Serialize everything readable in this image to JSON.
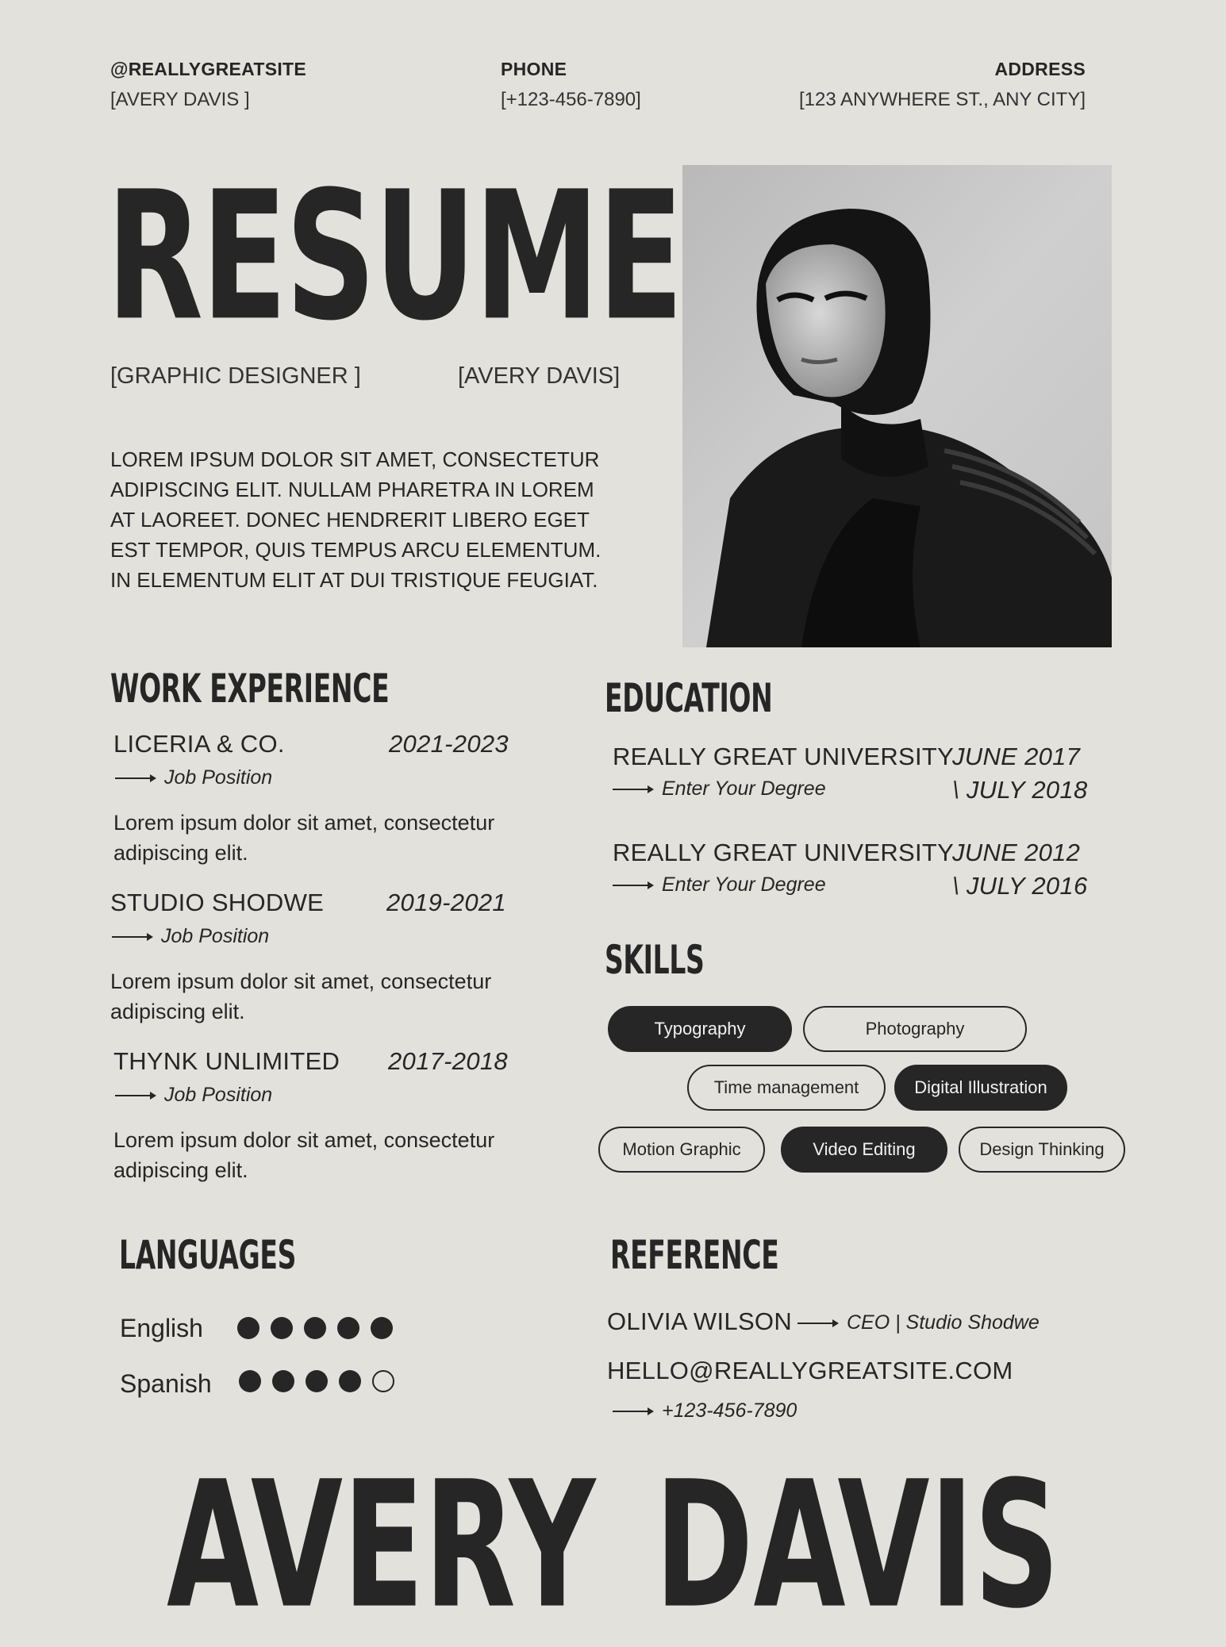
{
  "header": {
    "website_label": "@REALLYGREATSITE",
    "website_value": "[AVERY DAVIS ]",
    "phone_label": "PHONE",
    "phone_value": "[+123-456-7890]",
    "address_label": "ADDRESS",
    "address_value": "[123 ANYWHERE ST., ANY CITY]"
  },
  "hero": {
    "title": "RESUME",
    "role": "[GRAPHIC DESIGNER ]",
    "name": "[AVERY DAVIS]",
    "summary_lines": [
      "LOREM IPSUM DOLOR SIT AMET, CONSECTETUR",
      "ADIPISCING ELIT. NULLAM PHARETRA IN LOREM",
      "AT LAOREET. DONEC HENDRERIT LIBERO EGET",
      "EST TEMPOR, QUIS TEMPUS ARCU ELEMENTUM.",
      "IN ELEMENTUM ELIT AT DUI TRISTIQUE FEUGIAT."
    ]
  },
  "work": {
    "title": "WORK EXPERIENCE",
    "items": [
      {
        "company": "LICERIA & CO.",
        "years": "2021-2023",
        "position": "Job Position",
        "desc1": "Lorem ipsum dolor sit amet, consectetur",
        "desc2": "adipiscing elit."
      },
      {
        "company": "STUDIO SHODWE",
        "years": "2019-2021",
        "position": "Job Position",
        "desc1": "Lorem ipsum dolor sit amet, consectetur",
        "desc2": "adipiscing elit."
      },
      {
        "company": "THYNK UNLIMITED",
        "years": "2017-2018",
        "position": "Job Position",
        "desc1": "Lorem ipsum dolor sit amet, consectetur",
        "desc2": "adipiscing elit."
      }
    ]
  },
  "education": {
    "title": "EDUCATION",
    "items": [
      {
        "school": "REALLY GREAT UNIVERSITY",
        "date1": "JUNE 2017",
        "date2": "\\ JULY 2018",
        "degree": "Enter Your Degree"
      },
      {
        "school": "REALLY GREAT UNIVERSITY",
        "date1": "JUNE 2012",
        "date2": "\\ JULY 2016",
        "degree": "Enter Your Degree"
      }
    ]
  },
  "skills": {
    "title": "SKILLS",
    "items": [
      {
        "label": "Typography",
        "filled": true
      },
      {
        "label": "Photography",
        "filled": false
      },
      {
        "label": "Time management",
        "filled": false
      },
      {
        "label": "Digital Illustration",
        "filled": true
      },
      {
        "label": "Motion Graphic",
        "filled": false
      },
      {
        "label": "Video Editing",
        "filled": true
      },
      {
        "label": "Design Thinking",
        "filled": false
      }
    ]
  },
  "languages": {
    "title": "LANGUAGES",
    "items": [
      {
        "name": "English",
        "level": 5,
        "max": 5
      },
      {
        "name": "Spanish",
        "level": 4,
        "max": 5
      }
    ]
  },
  "reference": {
    "title": "REFERENCE",
    "name": "OLIVIA WILSON",
    "role": "CEO | Studio Shodwe",
    "email": "HELLO@REALLYGREATSITE.COM",
    "phone": "+123-456-7890"
  },
  "footer": {
    "first": "AVERY",
    "last": "DAVIS"
  },
  "colors": {
    "background": "#e2e1dc",
    "ink": "#262626"
  }
}
